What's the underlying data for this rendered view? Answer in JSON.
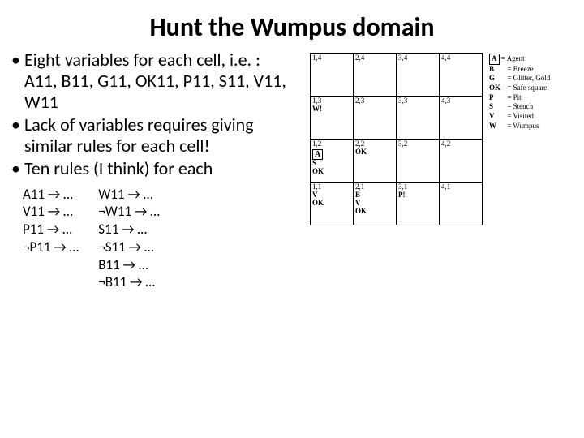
{
  "title": "Hunt the Wumpus domain",
  "bullets": [
    "Eight variables for each cell, i.e. : A11, B11, G11, OK11, P11, S11, V11, W11",
    "Lack of variables requires giving similar rules for each cell!",
    "Ten rules (I think) for each"
  ],
  "rules_col1": [
    "A11 → …",
    "V11 → …",
    "P11 → …",
    "¬P11 → …"
  ],
  "rules_col2": [
    "W11 → …",
    "¬W11 → …",
    "S11 → …",
    "¬S11 → …",
    "B11 → …",
    "¬B11 → …"
  ],
  "grid": [
    [
      {
        "c": "1,4"
      },
      {
        "c": "2,4"
      },
      {
        "c": "3,4"
      },
      {
        "c": "4,4"
      }
    ],
    [
      {
        "c": "1,3",
        "m": "W!"
      },
      {
        "c": "2,3"
      },
      {
        "c": "3,3"
      },
      {
        "c": "4,3"
      }
    ],
    [
      {
        "c": "1,2",
        "a": true,
        "m2": "S",
        "m3": "OK"
      },
      {
        "c": "2,2",
        "m3": "OK"
      },
      {
        "c": "3,2"
      },
      {
        "c": "4,2"
      }
    ],
    [
      {
        "c": "1,1",
        "m2": "V",
        "m3": "OK"
      },
      {
        "c": "2,1",
        "m": "B",
        "m2": "V",
        "m3": "OK"
      },
      {
        "c": "3,1",
        "m": "P!"
      },
      {
        "c": "4,1"
      }
    ]
  ],
  "legend": [
    {
      "sym": "A",
      "txt": "= Agent",
      "boxed": true
    },
    {
      "sym": "B",
      "txt": "= Breeze"
    },
    {
      "sym": "G",
      "txt": "= Glitter, Gold"
    },
    {
      "sym": "OK",
      "txt": "= Safe square"
    },
    {
      "sym": "P",
      "txt": "= Pit"
    },
    {
      "sym": "S",
      "txt": "= Stench"
    },
    {
      "sym": "V",
      "txt": "= Visited"
    },
    {
      "sym": "W",
      "txt": "= Wumpus"
    }
  ]
}
